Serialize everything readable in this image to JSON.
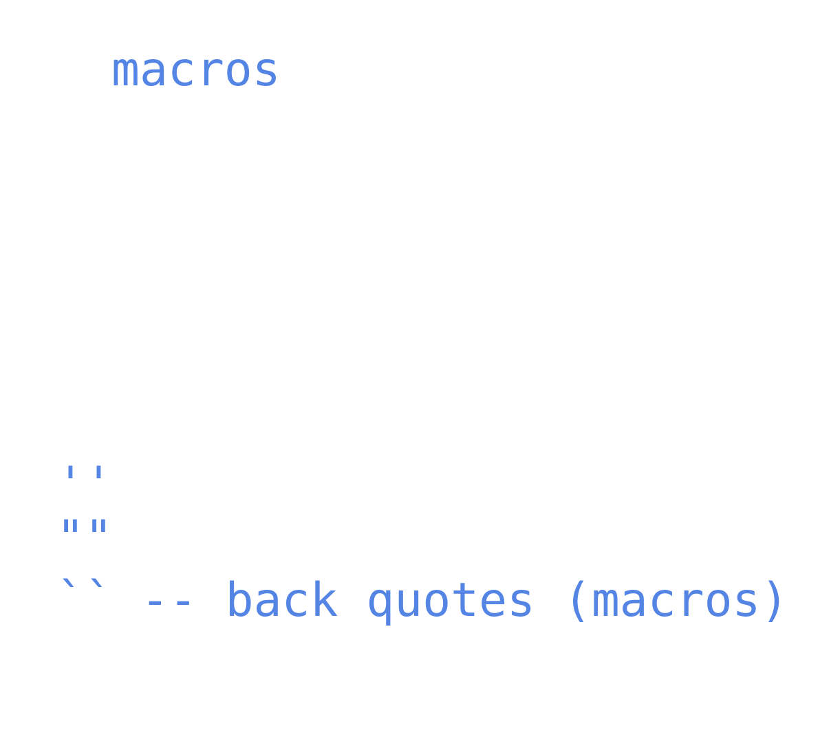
{
  "code": {
    "line_1": "macros",
    "line_2": "''",
    "line_3": "\"\"",
    "line_4": "`` -- back quotes (macros)"
  },
  "colors": {
    "text": "#5484e4",
    "background": "#ffffff"
  }
}
